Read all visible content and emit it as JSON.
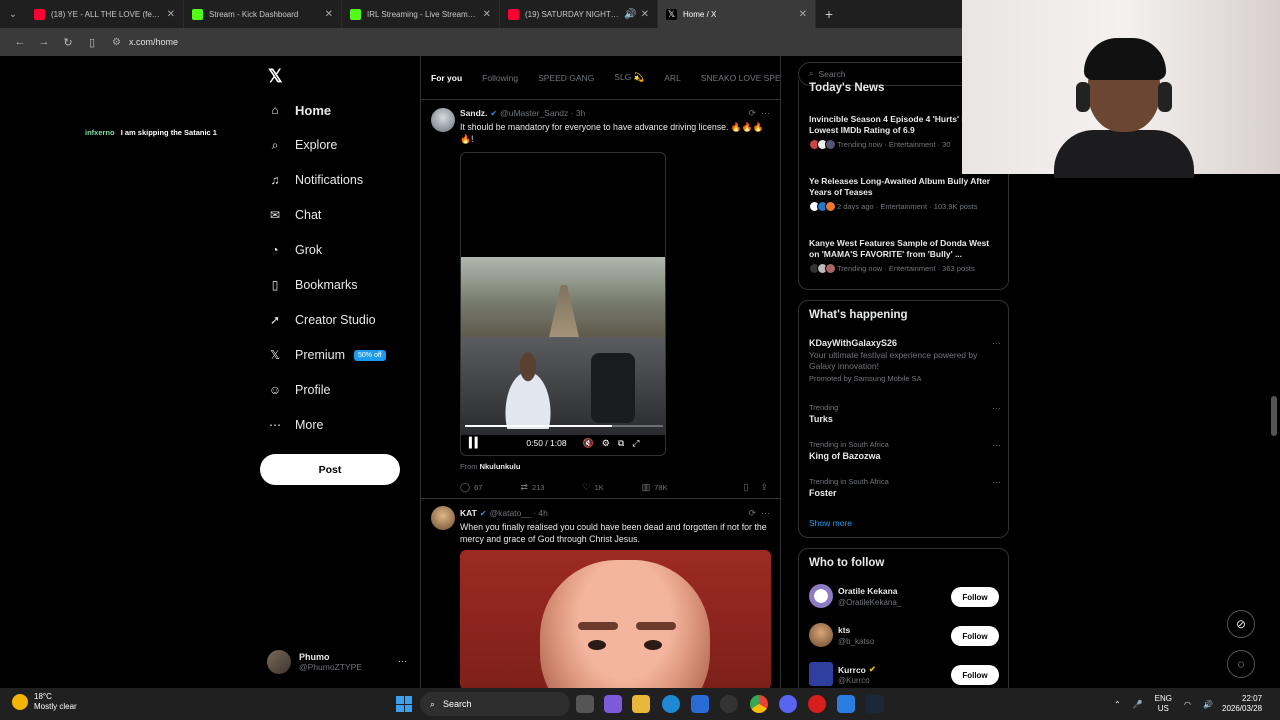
{
  "browser": {
    "tabs": [
      {
        "title": "(18) YE - ALL THE LOVE (feat. A",
        "color": "#ff0033"
      },
      {
        "title": "Stream - Kick Dashboard",
        "color": "#53fc18"
      },
      {
        "title": "IRL Streaming - Live Streams or",
        "color": "#53fc18"
      },
      {
        "title": "(19) SATURDAY NIGHT SREA",
        "color": "#ff0033"
      },
      {
        "title": "Home / X",
        "color": "#000000"
      }
    ],
    "url": "x.com/home"
  },
  "overlay": {
    "user": "infxerno",
    "message": "I am skipping the Satanic 1"
  },
  "nav": {
    "logo": "X",
    "items": [
      {
        "label": "Home",
        "icon": "home-icon"
      },
      {
        "label": "Explore",
        "icon": "search-icon"
      },
      {
        "label": "Notifications",
        "icon": "bell-icon"
      },
      {
        "label": "Chat",
        "icon": "mail-icon"
      },
      {
        "label": "Grok",
        "icon": "grok-icon"
      },
      {
        "label": "Bookmarks",
        "icon": "bookmark-icon"
      },
      {
        "label": "Creator Studio",
        "icon": "rocket-icon"
      },
      {
        "label": "Premium",
        "icon": "x-icon"
      },
      {
        "label": "Profile",
        "icon": "person-icon"
      },
      {
        "label": "More",
        "icon": "more-icon"
      }
    ],
    "premium_badge": "50% off",
    "post_label": "Post",
    "account": {
      "name": "Phumo",
      "handle": "@PhumoZTYPE"
    }
  },
  "timeline": {
    "tabs": [
      "For you",
      "Following",
      "SPEED GANG",
      "SLG 💫",
      "ARL",
      "SNEAKO LOVE SPE"
    ],
    "post1": {
      "name": "Sandz.",
      "handle": "@uMaster_Sandz · 3h",
      "text": "It should be mandatory for everyone to have advance driving license. 🔥🔥🔥🔥!",
      "video_time": "0:50 / 1:08",
      "video_progress": 0.74,
      "from_label": "From",
      "from_source": "Nkulunkulu",
      "replies": "67",
      "reposts": "213",
      "likes": "1K",
      "views": "78K"
    },
    "post2": {
      "name": "KAT",
      "handle": "@katato__ · 4h",
      "text": "When you finally realised you could have been dead and forgotten if not for the mercy and grace of God through Christ Jesus."
    }
  },
  "sidebar": {
    "search_placeholder": "Search",
    "news_title": "Today's News",
    "news": [
      {
        "title": "Invincible Season 4 Episode 4 'Hurts' Receives Lowest IMDb Rating of 6.9",
        "meta": "Trending now · Entertainment · 30"
      },
      {
        "title": "Ye Releases Long-Awaited Album Bully After Years of Teases",
        "meta": "2 days ago · Entertainment · 103.9K posts"
      },
      {
        "title": "Kanye West Features Sample of Donda West on 'MAMA'S FAVORITE' from 'Bully' ...",
        "meta": "Trending now · Entertainment · 363 posts"
      }
    ],
    "happening_title": "What's happening",
    "trends": [
      {
        "ctx": "",
        "name": "KDayWithGalaxyS26",
        "desc": "Your ultimate festival experience powered by Galaxy innovation!",
        "promo": "Promoted by Samsung Mobile SA"
      },
      {
        "ctx": "Trending",
        "name": "Turks"
      },
      {
        "ctx": "Trending in South Africa",
        "name": "King of Bazozwa"
      },
      {
        "ctx": "Trending in South Africa",
        "name": "Foster"
      }
    ],
    "show_more": "Show more",
    "wtf_title": "Who to follow",
    "follow_label": "Follow",
    "who_to_follow": [
      {
        "name": "Oratile Kekana",
        "handle": "@OratileKekana_"
      },
      {
        "name": "kts",
        "handle": "@b_katso"
      },
      {
        "name": "Kurrco",
        "handle": "@Kurrco"
      }
    ]
  },
  "taskbar": {
    "temp": "18°C",
    "weather": "Mostly clear",
    "search": "Search",
    "lang1": "ENG",
    "lang2": "US",
    "time": "22:07",
    "date": "2026/03/28"
  }
}
